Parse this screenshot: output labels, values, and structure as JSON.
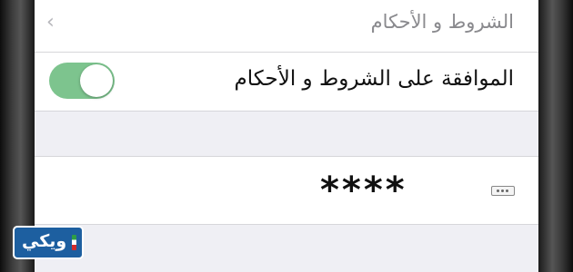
{
  "header": {
    "title": "الشروط و الأحكام",
    "back_icon": "chevron-left-icon"
  },
  "agreement": {
    "label": "الموافقة على الشروط و الأحكام",
    "toggle_on": true,
    "toggle_color": "#7dc48e"
  },
  "password": {
    "masked_value": "****",
    "icon": "keyboard-dots-icon"
  },
  "watermark": {
    "text": "ويكي"
  }
}
